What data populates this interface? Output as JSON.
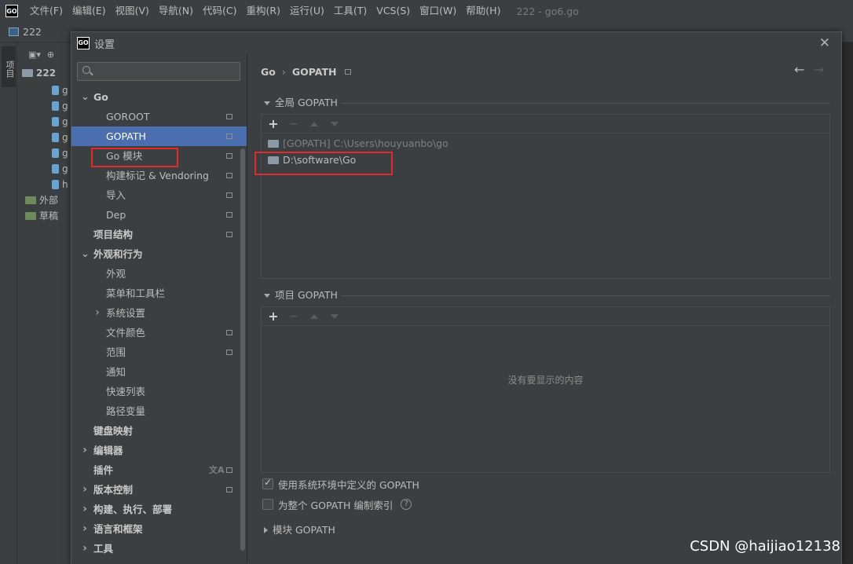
{
  "app": {
    "logo": "GO",
    "menu": [
      "文件(F)",
      "编辑(E)",
      "视图(V)",
      "导航(N)",
      "代码(C)",
      "重构(R)",
      "运行(U)",
      "工具(T)",
      "VCS(S)",
      "窗口(W)",
      "帮助(H)"
    ],
    "title": "222 - go6.go",
    "nav_label": "222",
    "stripe_tab": "项目",
    "tree": [
      {
        "label": "222"
      },
      {
        "label": "g"
      },
      {
        "label": "g"
      },
      {
        "label": "g"
      },
      {
        "label": "g"
      },
      {
        "label": "g"
      },
      {
        "label": "g"
      },
      {
        "label": "h"
      },
      {
        "label": "外部"
      },
      {
        "label": "草稿"
      }
    ]
  },
  "dialog": {
    "logo": "GO",
    "title": "设置",
    "close": "✕",
    "search_placeholder": "",
    "sidebar": [
      {
        "label": "Go",
        "level": 0,
        "bold": true,
        "expanded": true
      },
      {
        "label": "GOROOT",
        "level": 1,
        "mark": true
      },
      {
        "label": "GOPATH",
        "level": 1,
        "mark": true,
        "selected": true
      },
      {
        "label": "Go 模块",
        "level": 1,
        "mark": true
      },
      {
        "label": "构建标记 & Vendoring",
        "level": 1,
        "mark": true
      },
      {
        "label": "导入",
        "level": 1,
        "mark": true
      },
      {
        "label": "Dep",
        "level": 1,
        "mark": true
      },
      {
        "label": "项目结构",
        "level": 0,
        "bold": true,
        "mark": true
      },
      {
        "label": "外观和行为",
        "level": 0,
        "bold": true,
        "expanded": true
      },
      {
        "label": "外观",
        "level": 1
      },
      {
        "label": "菜单和工具栏",
        "level": 1
      },
      {
        "label": "系统设置",
        "level": 1,
        "collapsed": true
      },
      {
        "label": "文件颜色",
        "level": 1,
        "mark": true
      },
      {
        "label": "范围",
        "level": 1,
        "mark": true
      },
      {
        "label": "通知",
        "level": 1
      },
      {
        "label": "快速列表",
        "level": 1
      },
      {
        "label": "路径变量",
        "level": 1
      },
      {
        "label": "键盘映射",
        "level": 0,
        "bold": true
      },
      {
        "label": "编辑器",
        "level": 0,
        "bold": true,
        "collapsed": true
      },
      {
        "label": "插件",
        "level": 0,
        "bold": true,
        "mark": true,
        "translate": true
      },
      {
        "label": "版本控制",
        "level": 0,
        "bold": true,
        "collapsed": true,
        "mark": true
      },
      {
        "label": "构建、执行、部署",
        "level": 0,
        "bold": true,
        "collapsed": true
      },
      {
        "label": "语言和框架",
        "level": 0,
        "bold": true,
        "collapsed": true
      },
      {
        "label": "工具",
        "level": 0,
        "bold": true,
        "collapsed": true
      }
    ],
    "breadcrumb": {
      "root": "Go",
      "sep": "›",
      "page": "GOPATH"
    },
    "back_arrow": "←",
    "forward_arrow": "→",
    "global_section": {
      "title": "全局 GOPATH",
      "toolbar": {
        "add": "+",
        "remove": "−"
      },
      "paths": [
        {
          "text": "[GOPATH] C:\\Users\\houyuanbo\\go",
          "dim": true
        },
        {
          "text": "D:\\software\\Go",
          "dim": false
        }
      ]
    },
    "project_section": {
      "title": "项目 GOPATH",
      "toolbar": {
        "add": "+",
        "remove": "−"
      },
      "empty_text": "没有要显示的内容"
    },
    "use_system_env": {
      "label": "使用系统环境中定义的 GOPATH",
      "checked": true
    },
    "index_entire": {
      "label": "为整个 GOPATH 编制索引",
      "checked": false,
      "help": "?"
    },
    "module_section": {
      "title": "模块 GOPATH"
    }
  },
  "watermark": "CSDN @haijiao12138",
  "colors": {
    "selection": "#4b6eaf",
    "highlight_box": "#e02b2b",
    "background": "#3c3f41"
  }
}
